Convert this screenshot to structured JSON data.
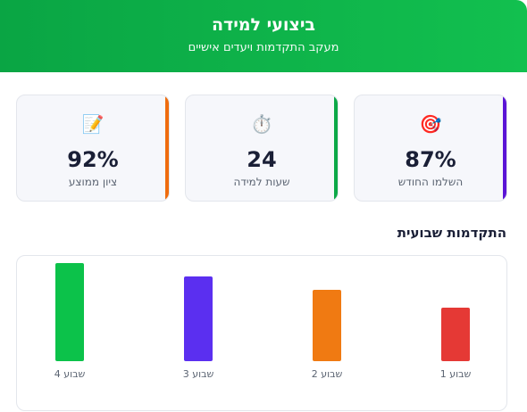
{
  "header": {
    "title": "ביצועי למידה",
    "subtitle": "מעקב התקדמות ויעדים אישיים"
  },
  "stats": [
    {
      "icon": "target-icon",
      "glyph": "🎯",
      "value": "87%",
      "label": "השלמו החודש",
      "accent": "#5b14d6"
    },
    {
      "icon": "stopwatch-icon",
      "glyph": "⏱️",
      "value": "24",
      "label": "שעות למידה",
      "accent": "#0ca847"
    },
    {
      "icon": "memo-icon",
      "glyph": "📝",
      "value": "92%",
      "label": "ציון ממוצע",
      "accent": "#ef6c0e"
    }
  ],
  "section": {
    "title": "התקדמות שבועית"
  },
  "chart_data": {
    "type": "bar",
    "categories": [
      "שבוע 1",
      "שבוע 2",
      "שבוע 3",
      "שבוע 4"
    ],
    "values": [
      60,
      80,
      95,
      110
    ],
    "ylim": [
      0,
      110
    ],
    "colors": [
      "#e53935",
      "#f07a12",
      "#5b2ff0",
      "#0cc24a"
    ],
    "grid": false,
    "title": "",
    "xlabel": "",
    "ylabel": ""
  }
}
